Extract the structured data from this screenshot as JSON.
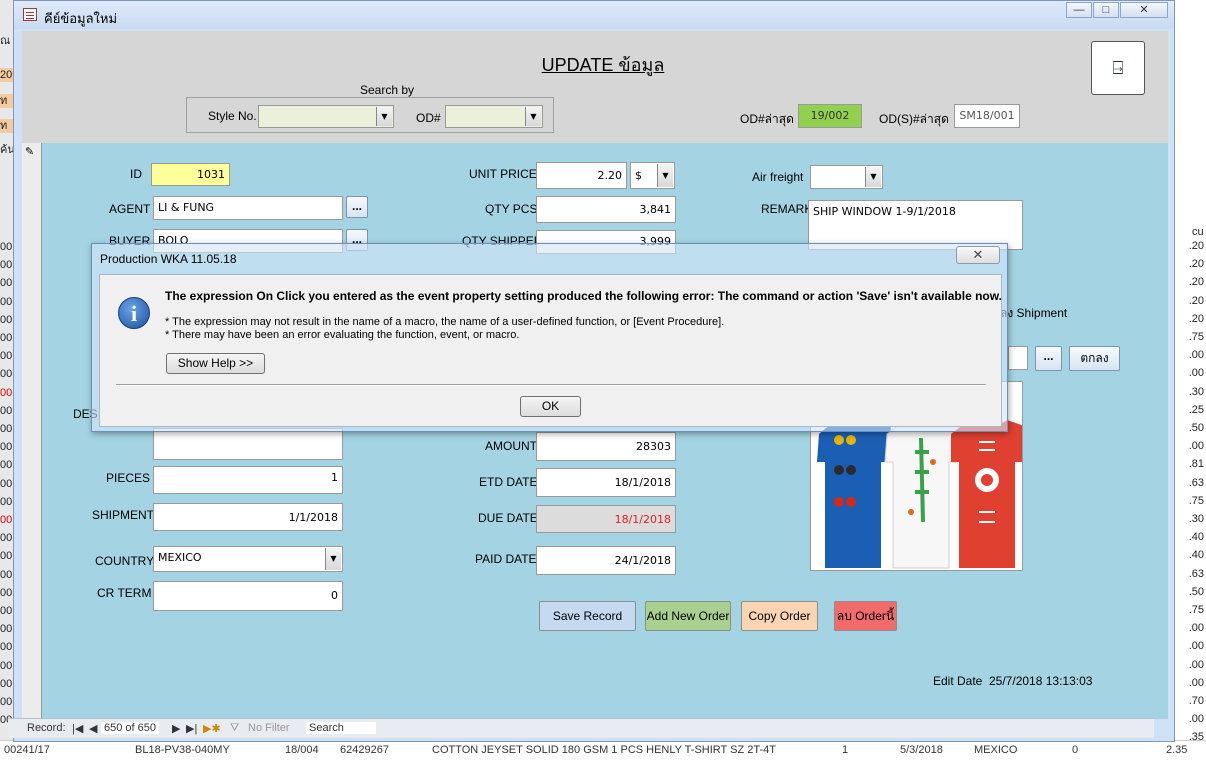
{
  "background_datasheet": {
    "left_cells": [
      "ณ",
      "20",
      "ท",
      "ท",
      "ค้น"
    ],
    "left_codes": [
      "00",
      "00",
      "00",
      "00",
      "00",
      "00",
      "00",
      "00",
      "00",
      "00",
      "00",
      "00",
      "00",
      "00",
      "00",
      "00",
      "00",
      "00",
      "00",
      "00",
      "00",
      "00",
      "00",
      "00",
      "00",
      "00",
      "00"
    ],
    "right_header": "cu",
    "right_values": [
      ".20",
      ".20",
      ".20",
      ".20",
      ".20",
      ".75",
      ".00",
      ".00",
      ".30",
      ".25",
      ".50",
      ".00",
      ".81",
      ".63",
      ".75",
      ".30",
      ".40",
      ".40",
      ".63",
      ".50",
      ".75",
      ".00",
      ".00",
      ".00",
      ".00",
      ".70",
      ".00",
      ".35"
    ],
    "bottom_row": {
      "code": "00241/17",
      "style": "BL18-PV38-040MY",
      "od": "18/004",
      "number": "62429267",
      "description": "COTTON JEYSET SOLID 180 GSM 1 PCS HENLY T-SHIRT SZ 2T-4T",
      "qty": "1",
      "date": "5/3/2018",
      "country": "MEXICO",
      "zero": "0",
      "amount": "2.35"
    }
  },
  "window": {
    "title": "คีย์ข้อมูลใหม่",
    "controls": [
      "—",
      "□",
      "✕"
    ]
  },
  "header": {
    "title": "UPDATE ข้อมูล",
    "search_by": "Search by",
    "style_label": "Style No.",
    "style_value": "",
    "od_label": "OD#",
    "od_value": "",
    "last_od_label": "OD#ล่าสุด",
    "last_od_value": "19/002",
    "last_ods_label": "OD(S)#ล่าสุด",
    "last_ods_value": "SM18/001",
    "exit_icon": "exit-door-icon"
  },
  "form": {
    "id_label": "ID",
    "id_value": "1031",
    "agent_label": "AGENT",
    "agent_value": "LI & FUNG",
    "buyer_label": "BUYER",
    "buyer_value": "BOLO",
    "desc_label": "DES",
    "pieces_label": "PIECES",
    "pieces_value": "1",
    "shipment_label": "SHIPMENT",
    "shipment_value": "1/1/2018",
    "country_label": "COUNTRY",
    "country_value": "MEXICO",
    "crterm_label": "CR TERM",
    "crterm_value": "0",
    "unit_price_label": "UNIT PRICE",
    "unit_price_value": "2.20",
    "currency_value": "$",
    "qty_pcs_label": "QTY PCS",
    "qty_pcs_value": "3,841",
    "qty_shipped_label": "QTY SHIPPED",
    "qty_shipped_value": "3,999",
    "amount_label": "AMOUNT",
    "amount_value": "28303",
    "etd_label": "ETD DATE",
    "etd_value": "18/1/2018",
    "due_label": "DUE DATE",
    "due_value": "18/1/2018",
    "paid_label": "PAID DATE",
    "paid_value": "24/1/2018",
    "air_freight_label": "Air freight",
    "air_freight_value": "",
    "remark_label": "REMARK",
    "remark_value": "SHIP WINDOW 1-9/1/2018",
    "shipment_section_label": "ลง Shipment",
    "ok_thai_button": "ตกลง",
    "dots_label": "...",
    "edit_date_label": "Edit Date",
    "edit_date_value": "25/7/2018 13:13:03"
  },
  "buttons": {
    "save": "Save Record",
    "add": "Add New Order",
    "copy": "Copy Order",
    "delete": "ลบ Orderนี้"
  },
  "colors": {
    "detail_bg": "#a4d4e3",
    "header_bg": "#d6d6d6",
    "id_field": "#ffff99",
    "last_od_field": "#92d050",
    "save_btn": "#c5d9f1",
    "add_btn": "#a9d08e",
    "copy_btn": "#fbd4b4",
    "delete_btn": "#f26b6b",
    "due_text": "#e02020"
  },
  "dialog": {
    "title": "Production WKA 11.05.18",
    "main_message": "The expression On Click you entered as the event property setting produced the following error: The command or action 'Save' isn't available now.",
    "line1": "* The expression may not result in the name of a macro, the name of a user-defined function, or [Event Procedure].",
    "line2": "* There may have been an error evaluating the function, event, or macro.",
    "show_help": "Show Help >>",
    "ok": "OK",
    "icon": "info-icon"
  },
  "navbar": {
    "record_label": "Record:",
    "position": "650 of 650",
    "no_filter": "No Filter",
    "search": "Search"
  }
}
